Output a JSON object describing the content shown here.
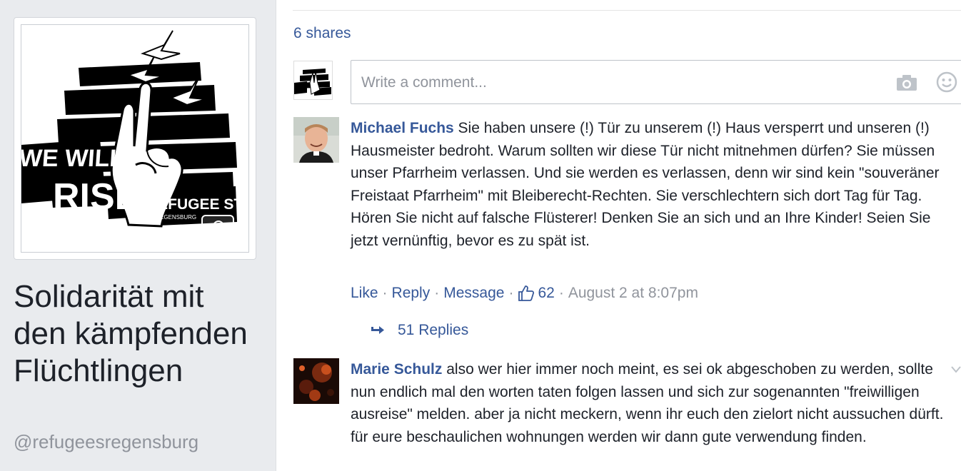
{
  "page": {
    "name": "Solidarität mit den kämpfenden Flüchtlingen",
    "handle": "@refugeesregensburg",
    "logo_text": [
      "WE WILL",
      "RISE",
      "REFUGEE STRIKE",
      "IN REGENSBURG"
    ]
  },
  "post": {
    "shares_label": "6 shares",
    "comment_placeholder": "Write a comment..."
  },
  "comments": [
    {
      "author": "Michael Fuchs",
      "text": "Sie haben unsere (!) Tür zu unserem (!) Haus versperrt und unseren (!) Hausmeister bedroht. Warum sollten wir diese Tür nicht mitnehmen dürfen? Sie müssen unser Pfarrheim verlassen. Und sie werden es verlassen, denn wir sind kein \"souveräner Freistaat Pfarrheim\" mit Bleiberecht-Rechten. Sie verschlechtern sich dort Tag für Tag. Hören Sie nicht auf falsche Flüsterer! Denken Sie an sich und an Ihre Kinder! Seien Sie jetzt vernünftig, bevor es zu spät ist.",
      "like_label": "Like",
      "reply_label": "Reply",
      "message_label": "Message",
      "likes": "62",
      "timestamp": "August 2 at 8:07pm",
      "replies_label": "51 Replies"
    },
    {
      "author": "Marie Schulz",
      "text": "also wer hier immer noch meint, es sei ok abgeschoben zu werden, sollte nun endlich mal den worten taten folgen lassen und sich zur sogenannten \"freiwilligen ausreise\" melden. aber ja nicht meckern, wenn ihr euch den zielort nicht aussuchen dürft. für eure beschaulichen wohnungen werden wir dann gute verwendung finden."
    }
  ],
  "colors": {
    "link": "#365899",
    "muted": "#90949c",
    "text": "#1d2129",
    "background": "#e9ebee"
  },
  "icons": [
    "camera-icon",
    "smiley-icon",
    "thumbs-up-icon",
    "reply-arrow-icon",
    "chevron-down-icon"
  ]
}
